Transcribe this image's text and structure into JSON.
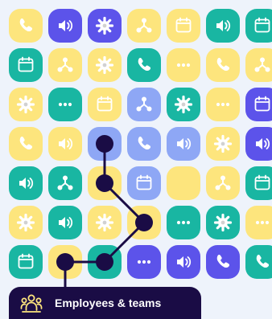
{
  "colors": {
    "yellow": "#fde57d",
    "indigo": "#5c53ea",
    "teal": "#19b6a2",
    "periwinkle": "#8ea7f5",
    "badge_bg": "#1a0c45",
    "path": "#1a0c45"
  },
  "grid": {
    "rows": [
      [
        [
          "yellow",
          "phone-icon"
        ],
        [
          "indigo",
          "speaker-icon"
        ],
        [
          "indigo",
          "gear-icon"
        ],
        [
          "yellow",
          "network-icon"
        ],
        [
          "yellow",
          "calendar-icon"
        ],
        [
          "teal",
          "speaker-icon"
        ],
        [
          "teal",
          "calendar-icon"
        ]
      ],
      [
        [
          "teal",
          "calendar-icon"
        ],
        [
          "yellow",
          "network-icon"
        ],
        [
          "yellow",
          "gear-icon"
        ],
        [
          "teal",
          "phone-icon"
        ],
        [
          "yellow",
          "dots-icon"
        ],
        [
          "yellow",
          "phone-icon"
        ],
        [
          "yellow",
          "network-icon"
        ]
      ],
      [
        [
          "yellow",
          "gear-icon"
        ],
        [
          "teal",
          "dots-icon"
        ],
        [
          "yellow",
          "calendar-icon"
        ],
        [
          "periwinkle",
          "network-icon"
        ],
        [
          "teal",
          "gear-icon"
        ],
        [
          "yellow",
          "dots-icon"
        ],
        [
          "indigo",
          "calendar-icon"
        ]
      ],
      [
        [
          "yellow",
          "phone-icon"
        ],
        [
          "yellow",
          "speaker-icon"
        ],
        [
          "periwinkle",
          "blank"
        ],
        [
          "periwinkle",
          "phone-icon"
        ],
        [
          "periwinkle",
          "speaker-icon"
        ],
        [
          "yellow",
          "gear-icon"
        ],
        [
          "indigo",
          "speaker-icon"
        ]
      ],
      [
        [
          "teal",
          "speaker-icon"
        ],
        [
          "teal",
          "network-icon"
        ],
        [
          "yellow",
          "blank"
        ],
        [
          "periwinkle",
          "calendar-icon"
        ],
        [
          "yellow",
          "blank"
        ],
        [
          "yellow",
          "network-icon"
        ],
        [
          "teal",
          "calendar-icon"
        ]
      ],
      [
        [
          "yellow",
          "gear-icon"
        ],
        [
          "teal",
          "speaker-icon"
        ],
        [
          "yellow",
          "gear-icon"
        ],
        [
          "yellow",
          "blank"
        ],
        [
          "teal",
          "dots-icon"
        ],
        [
          "teal",
          "gear-icon"
        ],
        [
          "yellow",
          "dots-icon"
        ]
      ],
      [
        [
          "teal",
          "calendar-icon"
        ],
        [
          "yellow",
          "blank"
        ],
        [
          "teal",
          "blank"
        ],
        [
          "indigo",
          "dots-icon"
        ],
        [
          "indigo",
          "speaker-icon"
        ],
        [
          "indigo",
          "phone-icon"
        ],
        [
          "teal",
          "phone-icon"
        ]
      ]
    ],
    "path_cells": [
      [
        3,
        2
      ],
      [
        4,
        2
      ],
      [
        5,
        3
      ],
      [
        6,
        2
      ],
      [
        6,
        1
      ]
    ]
  },
  "badge": {
    "icon": "team-icon",
    "label": "Employees & teams"
  }
}
